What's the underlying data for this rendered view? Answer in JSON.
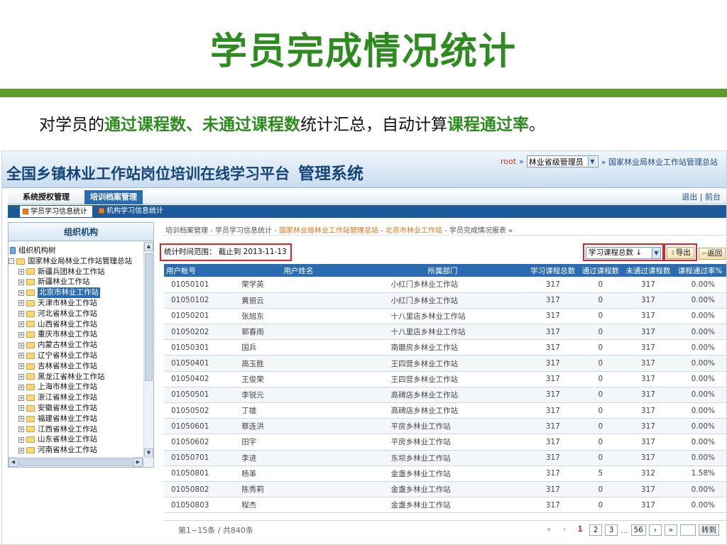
{
  "slide": {
    "title": "学员完成情况统计",
    "subtitle_parts": [
      "对学员的",
      "通过课程数、未通过课程数",
      "统计汇总，自动计算",
      "课程通过率",
      "。"
    ]
  },
  "app": {
    "logo": "全国乡镇林业工作站岗位培训在线学习平台",
    "logo_suffix": "管理系统",
    "user": "root",
    "sep": "»",
    "role": "林业省级管理员",
    "org_link": "» 国家林业局林业工作站管理总站",
    "main_tabs": [
      "系统授权管理",
      "培训档案管理"
    ],
    "logout": "退出",
    "divider": "|",
    "front": "前台",
    "sub_tabs": [
      "学员学习信息统计",
      "机构学习信息统计"
    ]
  },
  "org": {
    "title": "组织机构",
    "root": "组织机构树",
    "hq": "国家林业局林业工作站管理总站",
    "nodes": [
      "新疆兵团林业工作站",
      "新疆林业工作站",
      "北京市林业工作站",
      "天津市林业工作站",
      "河北省林业工作站",
      "山西省林业工作站",
      "重庆市林业工作站",
      "内蒙古林业工作站",
      "辽宁省林业工作站",
      "吉林省林业工作站",
      "黑龙江省林业工作站",
      "上海市林业工作站",
      "浙江省林业工作站",
      "安徽省林业工作站",
      "福建省林业工作站",
      "江西省林业工作站",
      "山东省林业工作站",
      "河南省林业工作站"
    ],
    "selected": "北京市林业工作站"
  },
  "breadcrumb": {
    "p1": "培训档案管理 - 学员学习信息统计 - ",
    "l1": "国家林业局林业工作站管理总站",
    "p2": " - ",
    "l2": "北京市林业工作站",
    "p3": " - 学员完成情况报表 »"
  },
  "toolbar": {
    "range": "统计时间范围： 截止到  2013-11-13",
    "sort": "学习课程总数 ↓",
    "export": "导出",
    "back": "返回"
  },
  "table": {
    "headers": [
      "用户帐号",
      "用户姓名",
      "所属部门",
      "学习课程总数",
      "通过课程数",
      "未通过课程数",
      "课程通过率%"
    ],
    "rows": [
      [
        "01050101",
        "荣学英",
        "小红门乡林业工作站",
        "317",
        "0",
        "317",
        "0.00%"
      ],
      [
        "01050102",
        "黄丽云",
        "小红门乡林业工作站",
        "317",
        "0",
        "317",
        "0.00%"
      ],
      [
        "01050201",
        "张旭东",
        "十八里店乡林业工作站",
        "317",
        "0",
        "317",
        "0.00%"
      ],
      [
        "01050202",
        "郭春雨",
        "十八里店乡林业工作站",
        "317",
        "0",
        "317",
        "0.00%"
      ],
      [
        "01050301",
        "国兵",
        "南磨房乡林业工作站",
        "317",
        "0",
        "317",
        "0.00%"
      ],
      [
        "01050401",
        "高玉胜",
        "王四营乡林业工作站",
        "317",
        "0",
        "317",
        "0.00%"
      ],
      [
        "01050402",
        "王俊荣",
        "王四营乡林业工作站",
        "317",
        "0",
        "317",
        "0.00%"
      ],
      [
        "01050501",
        "李锐元",
        "高碑店乡林业工作站",
        "317",
        "0",
        "317",
        "0.00%"
      ],
      [
        "01050502",
        "丁雄",
        "高碑店乡林业工作站",
        "317",
        "0",
        "317",
        "0.00%"
      ],
      [
        "01050601",
        "蔡连洪",
        "平房乡林业工作站",
        "317",
        "0",
        "317",
        "0.00%"
      ],
      [
        "01050602",
        "田宇",
        "平房乡林业工作站",
        "317",
        "0",
        "317",
        "0.00%"
      ],
      [
        "01050701",
        "李进",
        "东坝乡林业工作站",
        "317",
        "0",
        "317",
        "0.00%"
      ],
      [
        "01050801",
        "杨革",
        "金盏乡林业工作站",
        "317",
        "5",
        "312",
        "1.58%"
      ],
      [
        "01050802",
        "陈秀莉",
        "金盏乡林业工作站",
        "317",
        "0",
        "317",
        "0.00%"
      ],
      [
        "01050803",
        "程杰",
        "金盏乡林业工作站",
        "317",
        "0",
        "317",
        "0.00%"
      ]
    ]
  },
  "pager": {
    "info": "第1~15条 / 共840条",
    "first": "«",
    "prev": "‹",
    "pages": [
      "1",
      "2",
      "3"
    ],
    "ellipsis": "...",
    "last_page": "56",
    "next": "›",
    "last": "»",
    "go": "转到"
  },
  "colors": {
    "accent": "#2e8b1f",
    "header_blue": "#2a6cb0",
    "highlight_red": "#d9262b"
  }
}
